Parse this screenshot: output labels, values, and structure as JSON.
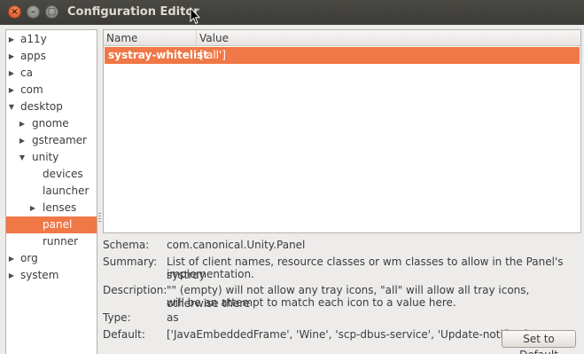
{
  "window": {
    "title": "Configuration Editor",
    "controls": {
      "close": "×",
      "minimize": "–",
      "maximize": "□"
    }
  },
  "tree": {
    "items": [
      {
        "label": "a11y",
        "depth": 0,
        "expander": "collapsed"
      },
      {
        "label": "apps",
        "depth": 0,
        "expander": "collapsed"
      },
      {
        "label": "ca",
        "depth": 0,
        "expander": "collapsed"
      },
      {
        "label": "com",
        "depth": 0,
        "expander": "collapsed"
      },
      {
        "label": "desktop",
        "depth": 0,
        "expander": "expanded"
      },
      {
        "label": "gnome",
        "depth": 1,
        "expander": "collapsed"
      },
      {
        "label": "gstreamer",
        "depth": 1,
        "expander": "collapsed"
      },
      {
        "label": "unity",
        "depth": 1,
        "expander": "expanded"
      },
      {
        "label": "devices",
        "depth": 2,
        "expander": "none"
      },
      {
        "label": "launcher",
        "depth": 2,
        "expander": "none"
      },
      {
        "label": "lenses",
        "depth": 2,
        "expander": "collapsed"
      },
      {
        "label": "panel",
        "depth": 2,
        "expander": "none",
        "selected": true
      },
      {
        "label": "runner",
        "depth": 2,
        "expander": "none"
      },
      {
        "label": "org",
        "depth": 0,
        "expander": "collapsed"
      },
      {
        "label": "system",
        "depth": 0,
        "expander": "collapsed"
      }
    ]
  },
  "keys": {
    "columns": {
      "name": "Name",
      "value": "Value"
    },
    "rows": [
      {
        "name": "systray-whitelist",
        "value": "['all']"
      }
    ]
  },
  "details": {
    "schema_label": "Schema:",
    "schema_value": "com.canonical.Unity.Panel",
    "summary_label": "Summary:",
    "summary_line1": "List of client names, resource classes or wm classes to allow in the Panel's systray",
    "summary_line2": "implementation.",
    "description_label": "Description:",
    "description_line1": "\"\" (empty) will not allow any tray icons, \"all\" will allow all tray icons, otherwise there",
    "description_line2": "will be an attempt to match each icon to a value here.",
    "type_label": "Type:",
    "type_value": "as",
    "default_label": "Default:",
    "default_value": "['JavaEmbeddedFrame', 'Wine', 'scp-dbus-service', 'Update-notifier']",
    "set_default_label": "Set to Default"
  },
  "colors": {
    "selection": "#f07746",
    "titlebar": "#3c3b37",
    "window_bg": "#edeceb"
  }
}
